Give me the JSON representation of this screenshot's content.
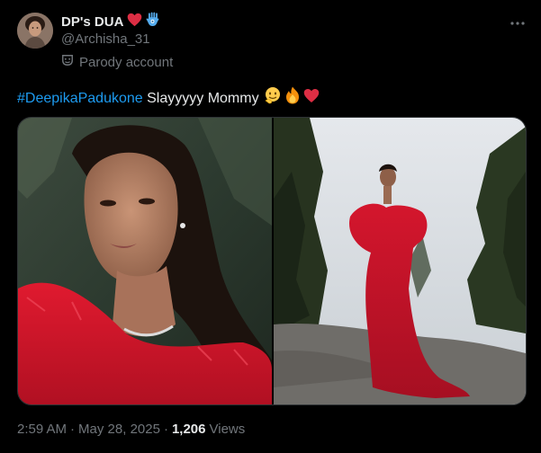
{
  "author": {
    "display_name": "DP's DUA",
    "name_emojis": [
      "heart-icon",
      "hamsa-icon"
    ],
    "handle": "@Archisha_31",
    "label": "Parody account"
  },
  "tweet": {
    "hashtag": "#DeepikaPadukone",
    "text": " Slayyyyy Mommy",
    "emojis": [
      "face-icon",
      "fire-icon",
      "heart-icon"
    ]
  },
  "meta": {
    "time": "2:59 AM",
    "separator": "·",
    "date": "May 28, 2025",
    "views_count": "1,206",
    "views_label": "Views"
  },
  "colors": {
    "background": "#000000",
    "accent": "#1d9bf0",
    "secondary_text": "#71767b",
    "primary_text": "#e7e9ea",
    "dress_red": "#c8142b"
  }
}
